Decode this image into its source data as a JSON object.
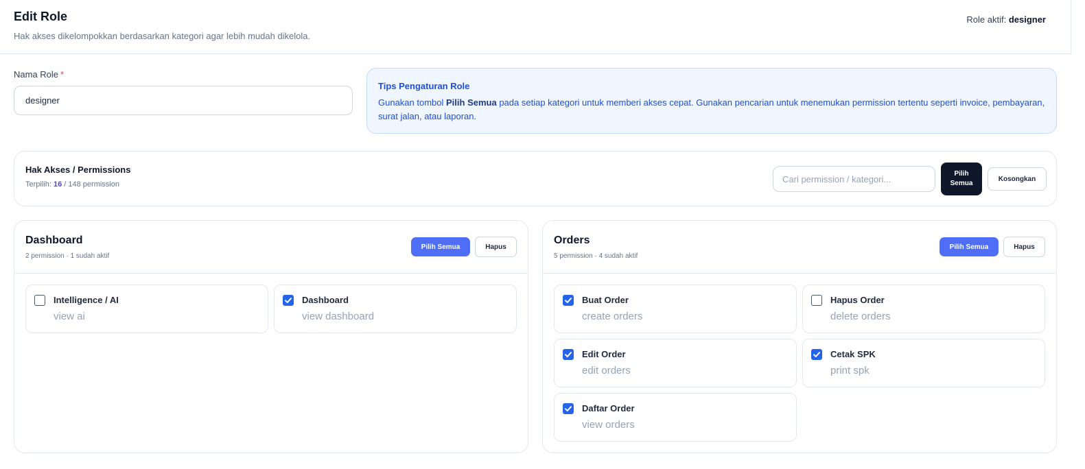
{
  "header": {
    "title": "Edit Role",
    "subtitle": "Hak akses dikelompokkan berdasarkan kategori agar lebih mudah dikelola.",
    "role_active_label": "Role aktif:",
    "role_active_value": "designer"
  },
  "form": {
    "name_label": "Nama Role",
    "required_mark": "*",
    "name_value": "designer"
  },
  "tips": {
    "title": "Tips Pengaturan Role",
    "body_before": "Gunakan tombol ",
    "body_bold": "Pilih Semua",
    "body_after": " pada setiap kategori untuk memberi akses cepat. Gunakan pencarian untuk menemukan permission tertentu seperti invoice, pembayaran, surat jalan, atau laporan."
  },
  "permissions": {
    "title": "Hak Akses / Permissions",
    "selected_prefix": "Terpilih: ",
    "selected": "16",
    "total_text": " / 148 permission",
    "search_placeholder": "Cari permission / kategori...",
    "select_all_label": "Pilih Semua",
    "clear_label": "Kosongkan"
  },
  "categories": {
    "dashboard": {
      "title": "Dashboard",
      "meta": "2 permission · 1 sudah aktif",
      "select_all_label": "Pilih Semua",
      "remove_label": "Hapus",
      "items": [
        {
          "label": "Intelligence / AI",
          "key": "view ai",
          "checked": false
        },
        {
          "label": "Dashboard",
          "key": "view dashboard",
          "checked": true
        }
      ]
    },
    "orders": {
      "title": "Orders",
      "meta": "5 permission · 4 sudah aktif",
      "select_all_label": "Pilih Semua",
      "remove_label": "Hapus",
      "items": [
        {
          "label": "Buat Order",
          "key": "create orders",
          "checked": true
        },
        {
          "label": "Hapus Order",
          "key": "delete orders",
          "checked": false
        },
        {
          "label": "Edit Order",
          "key": "edit orders",
          "checked": true
        },
        {
          "label": "Cetak SPK",
          "key": "print spk",
          "checked": true
        },
        {
          "label": "Daftar Order",
          "key": "view orders",
          "checked": true
        }
      ]
    }
  },
  "colors": {
    "primary": "#4f6ef7",
    "checkbox_checked": "#2563eb",
    "dark_button": "#0f172a",
    "tips_bg": "#eff6ff",
    "tips_text": "#1d4ed8"
  }
}
